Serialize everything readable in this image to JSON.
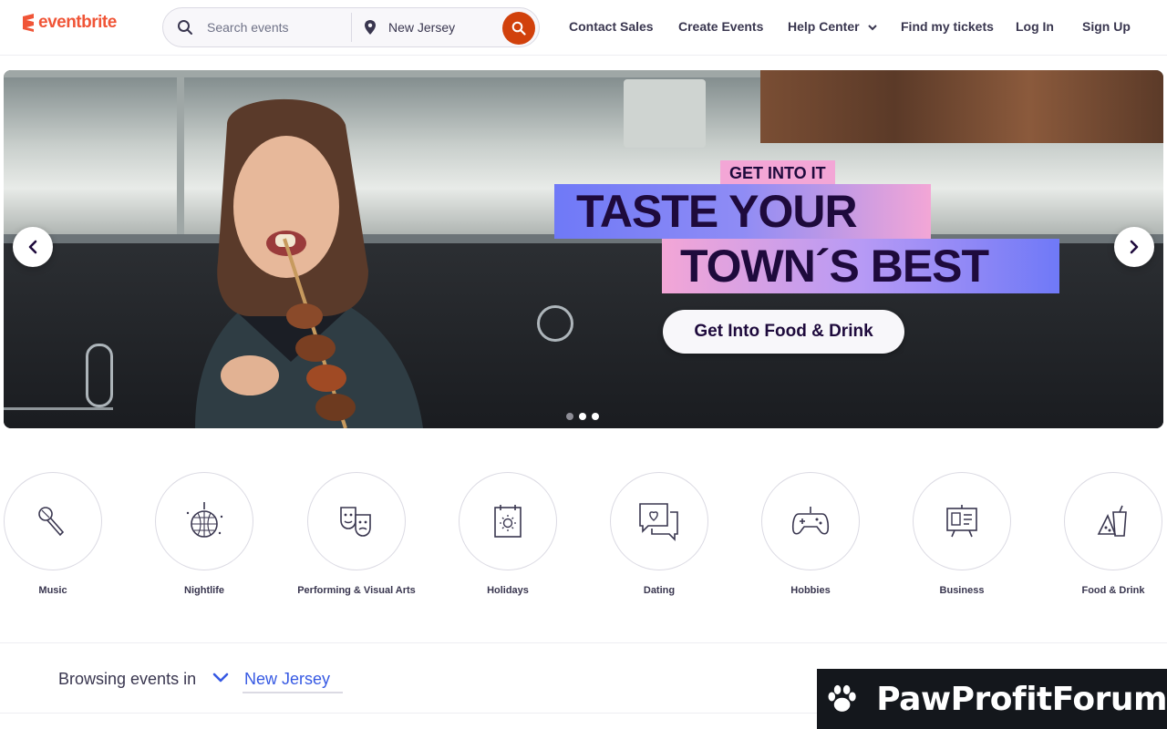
{
  "brand": {
    "name": "eventbrite",
    "accent": "#f05537"
  },
  "search": {
    "placeholder": "Search events",
    "location_value": "New Jersey",
    "button_color": "#d1410c"
  },
  "nav": {
    "items": [
      {
        "label": "Contact Sales"
      },
      {
        "label": "Create Events"
      },
      {
        "label": "Help Center"
      },
      {
        "label": "Find my tickets"
      },
      {
        "label": "Log In"
      },
      {
        "label": "Sign Up"
      }
    ]
  },
  "hero": {
    "eyebrow": "GET INTO IT",
    "headline_line1": "TASTE YOUR",
    "headline_line2": "TOWN´S BEST",
    "cta_label": "Get Into Food & Drink",
    "slides_total": 3,
    "active_slide": 2
  },
  "categories": [
    {
      "label": "Music",
      "icon": "microphone-icon"
    },
    {
      "label": "Nightlife",
      "icon": "disco-ball-icon"
    },
    {
      "label": "Performing & Visual Arts",
      "icon": "theater-masks-icon"
    },
    {
      "label": "Holidays",
      "icon": "calendar-sun-icon"
    },
    {
      "label": "Dating",
      "icon": "chat-heart-icon"
    },
    {
      "label": "Hobbies",
      "icon": "gamepad-icon"
    },
    {
      "label": "Business",
      "icon": "presentation-board-icon"
    },
    {
      "label": "Food & Drink",
      "icon": "food-drink-icon"
    }
  ],
  "browsing": {
    "label": "Browsing events in",
    "location": "New Jersey"
  },
  "watermark": {
    "text": "PawProfitForum"
  }
}
